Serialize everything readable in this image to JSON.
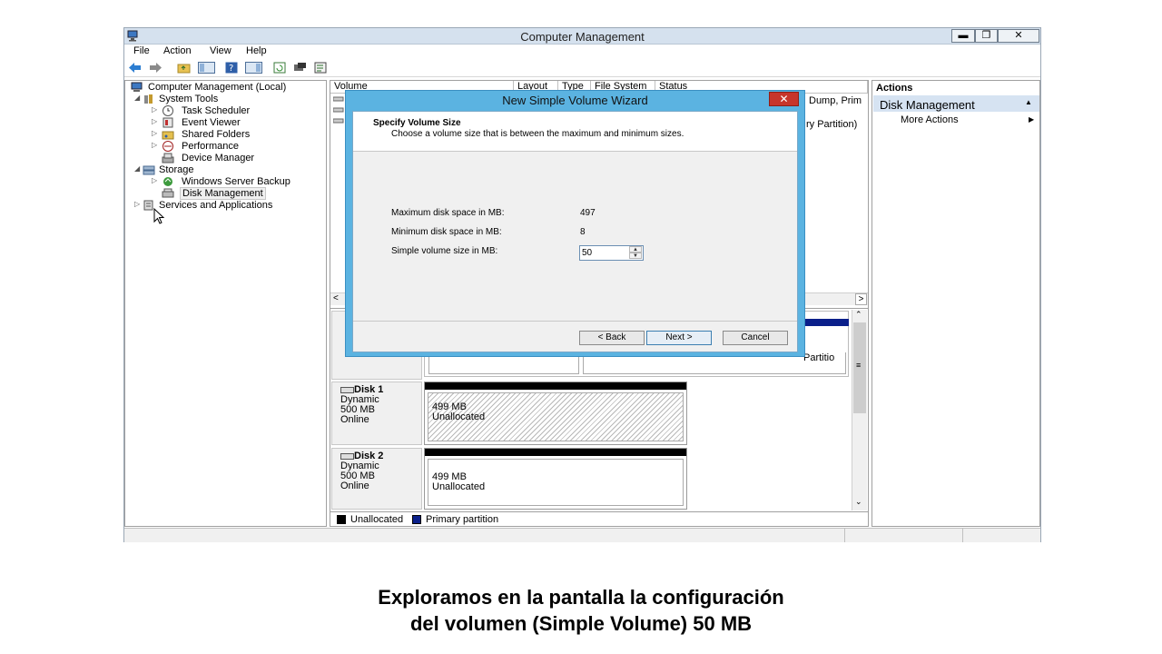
{
  "window": {
    "title": "Computer Management",
    "minimize": "▬",
    "restore": "❐",
    "close": "✕"
  },
  "menu": [
    "File",
    "Action",
    "View",
    "Help"
  ],
  "tree": [
    {
      "label": "Computer Management (Local)",
      "level": 0,
      "expander": "",
      "icon": "computer-management-icon"
    },
    {
      "label": "System Tools",
      "level": 1,
      "expander": "◢",
      "icon": "tools-icon"
    },
    {
      "label": "Task Scheduler",
      "level": 2,
      "expander": "▷",
      "icon": "clock-icon"
    },
    {
      "label": "Event Viewer",
      "level": 2,
      "expander": "▷",
      "icon": "event-viewer-icon"
    },
    {
      "label": "Shared Folders",
      "level": 2,
      "expander": "▷",
      "icon": "shared-folder-icon"
    },
    {
      "label": "Performance",
      "level": 2,
      "expander": "▷",
      "icon": "performance-icon"
    },
    {
      "label": "Device Manager",
      "level": 2,
      "expander": "",
      "icon": "device-manager-icon"
    },
    {
      "label": "Storage",
      "level": 1,
      "expander": "◢",
      "icon": "storage-icon"
    },
    {
      "label": "Windows Server Backup",
      "level": 2,
      "expander": "▷",
      "icon": "backup-icon"
    },
    {
      "label": "Disk Management",
      "level": 2,
      "expander": "",
      "icon": "disk-management-icon",
      "selected": true
    },
    {
      "label": "Services and Applications",
      "level": 1,
      "expander": "▷",
      "icon": "services-icon"
    }
  ],
  "columns": [
    "Volume",
    "Layout",
    "Type",
    "File System",
    "Status"
  ],
  "volume_rows_right": [
    "Dump, Prim",
    "ry Partition)"
  ],
  "lower_pane": {
    "partial_row_right": "Partitio",
    "disks": [
      {
        "name": "Disk 1",
        "type": "Dynamic",
        "size": "500 MB",
        "status": "Online",
        "partition": {
          "size": "499 MB",
          "label": "Unallocated"
        }
      },
      {
        "name": "Disk 2",
        "type": "Dynamic",
        "size": "500 MB",
        "status": "Online",
        "partition": {
          "size": "499 MB",
          "label": "Unallocated"
        }
      }
    ],
    "legend": [
      {
        "label": "Unallocated",
        "color": "#000000"
      },
      {
        "label": "Primary partition",
        "color": "#0a1f8a"
      }
    ]
  },
  "actions": {
    "header": "Actions",
    "section": "Disk Management",
    "section_arrow": "▲",
    "items": [
      {
        "label": "More Actions",
        "arrow": "▶"
      }
    ]
  },
  "wizard": {
    "title": "New Simple Volume Wizard",
    "close": "✕",
    "heading": "Specify Volume Size",
    "subheading": "Choose a volume size that is between the maximum and minimum sizes.",
    "fields": [
      {
        "label": "Maximum disk space in MB:",
        "value": "497"
      },
      {
        "label": "Minimum disk space in MB:",
        "value": "8"
      }
    ],
    "size_label": "Simple volume size in MB:",
    "size_value": "50",
    "buttons": {
      "back": "< Back",
      "next": "Next >",
      "cancel": "Cancel"
    }
  },
  "caption": {
    "line1": "Exploramos en la pantalla la configuración",
    "line2": "del volumen (Simple Volume) 50 MB"
  },
  "colors": {
    "title_bar": "#d5e1ee",
    "wizard_frame": "#5bb3e1",
    "wizard_close": "#c7352b",
    "primary_partition": "#0a1f8a"
  }
}
